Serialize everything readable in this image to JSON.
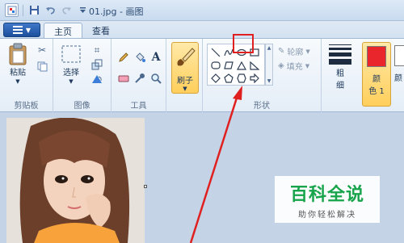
{
  "window": {
    "title": "01.jpg - 画图"
  },
  "quick_access": {
    "icons": [
      "paint-app-icon",
      "save-icon",
      "undo-icon",
      "redo-icon",
      "customize-icon"
    ]
  },
  "tabs": [
    {
      "label": "主页",
      "active": true
    },
    {
      "label": "查看",
      "active": false
    }
  ],
  "ribbon": {
    "clipboard": {
      "label": "剪贴板",
      "paste_label": "粘贴"
    },
    "image": {
      "label": "图像",
      "select_label": "选择"
    },
    "tools": {
      "label": "工具",
      "text_glyph": "A"
    },
    "brushes": {
      "label": "刷子"
    },
    "shapes": {
      "label": "形状",
      "outline_label": "轮廓",
      "fill_label": "填充"
    },
    "size": {
      "label": "粗",
      "label2": "细"
    },
    "color1": {
      "label": "颜",
      "label2": "色 1",
      "color": "#e8262b"
    },
    "color2": {
      "label": "颜"
    }
  },
  "annotation": {
    "highlight_color": "#e02020",
    "target": "oval-shape"
  },
  "watermark": {
    "main": "百科全说",
    "sub": "助你轻松解决",
    "color": "#17a44b"
  }
}
